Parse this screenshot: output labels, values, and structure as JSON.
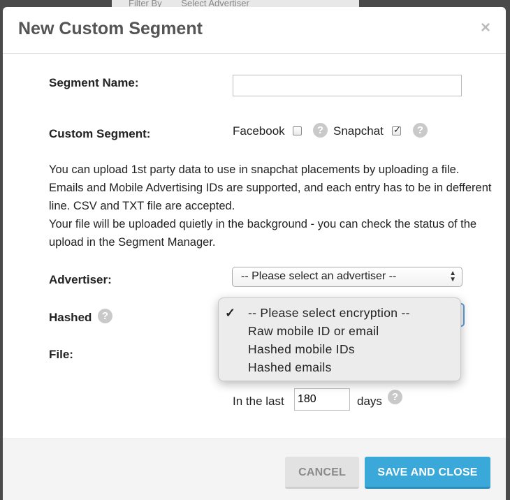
{
  "backdrop": {
    "filter_label": "Filter By",
    "filter_value": "Select Advertiser"
  },
  "modal": {
    "title": "New Custom Segment",
    "close_glyph": "×"
  },
  "form": {
    "segment_name_label": "Segment Name:",
    "segment_name_value": "",
    "custom_segment_label": "Custom Segment:",
    "facebook_label": "Facebook",
    "facebook_checked": false,
    "snapchat_label": "Snapchat",
    "snapchat_checked": true,
    "help_glyph": "?",
    "description_line1": "You can upload 1st party data to use in snapchat placements by uploading a file. Emails and Mobile Advertising IDs are supported, and each entry has to be in defferent line. CSV and TXT file are accepted.",
    "description_line2": "Your file will be uploaded quietly in the background - you can check the status of the upload in the Segment Manager.",
    "advertiser_label": "Advertiser:",
    "advertiser_selected": "-- Please select an advertiser --",
    "hashed_label": "Hashed",
    "file_label": "File:",
    "in_the_last_label": "In the last",
    "days_value": "180",
    "days_label": "days"
  },
  "encryption_dropdown": {
    "options": [
      "-- Please select encryption --",
      "Raw mobile ID or email",
      "Hashed mobile IDs",
      "Hashed emails"
    ],
    "selected_index": 0,
    "check_glyph": "✓"
  },
  "footer": {
    "cancel_label": "CANCEL",
    "save_label": "SAVE AND CLOSE"
  },
  "colors": {
    "primary": "#3aa8d8",
    "cancel_bg": "#e2e2e2",
    "help_icon": "#c9c9c9",
    "focus_ring": "#5b9dd9"
  }
}
